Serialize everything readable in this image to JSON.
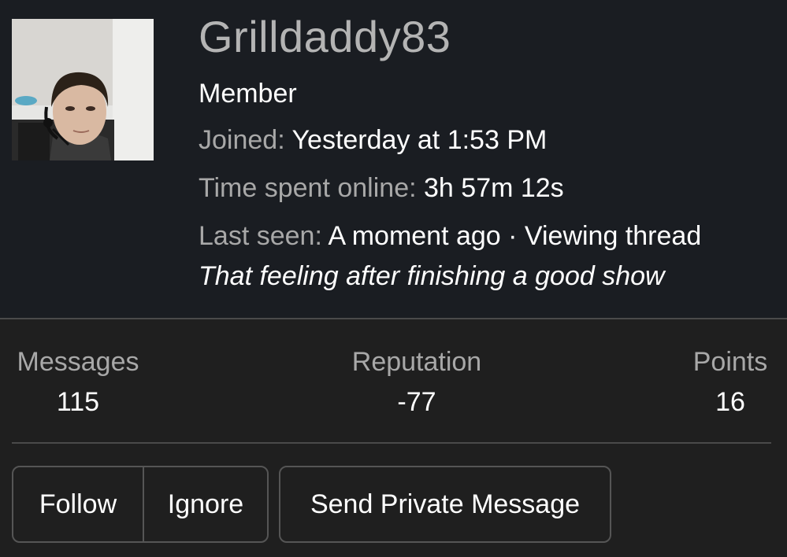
{
  "profile": {
    "username": "Grilldaddy83",
    "role": "Member",
    "joined_label": "Joined:",
    "joined_value": "Yesterday at 1:53 PM",
    "online_label": "Time spent online:",
    "online_value": "3h 57m 12s",
    "last_seen_label": "Last seen:",
    "last_seen_value": "A moment ago · Viewing thread",
    "status_message": "That feeling after finishing a good show"
  },
  "stats": [
    {
      "label": "Messages",
      "value": "115"
    },
    {
      "label": "Reputation",
      "value": "-77"
    },
    {
      "label": "Points",
      "value": "16"
    }
  ],
  "actions": {
    "follow_label": "Follow",
    "ignore_label": "Ignore",
    "pm_label": "Send Private Message"
  },
  "colors": {
    "header_bg": "#1a1d22",
    "page_bg": "#1f1f1f",
    "muted_text": "#a8a8a8",
    "border": "#555555"
  }
}
